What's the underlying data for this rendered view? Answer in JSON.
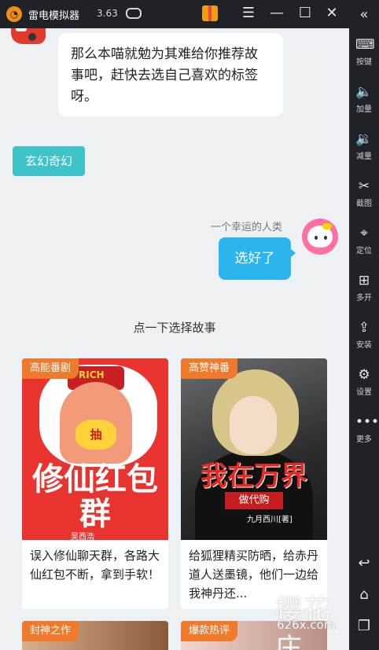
{
  "titlebar": {
    "app_title": "雷电模拟器",
    "version": "3.63"
  },
  "sidebar": {
    "items": [
      {
        "label": "按键",
        "icon": "keyboard-icon"
      },
      {
        "label": "加量",
        "icon": "volume-up-icon"
      },
      {
        "label": "减量",
        "icon": "volume-down-icon"
      },
      {
        "label": "截图",
        "icon": "scissors-icon"
      },
      {
        "label": "定位",
        "icon": "location-pin-icon"
      },
      {
        "label": "多开",
        "icon": "multi-open-icon"
      },
      {
        "label": "安装",
        "icon": "apk-install-icon"
      },
      {
        "label": "设置",
        "icon": "gear-icon"
      },
      {
        "label": "更多",
        "icon": "more-dots-icon"
      }
    ]
  },
  "chat": {
    "bot_message": "那么本喵就勉为其难给你推荐故事吧，赶快去选自己喜欢的标签呀。",
    "tag_selected": "玄幻奇幻",
    "user_name": "一个幸运的人类",
    "user_message": "选好了"
  },
  "stories": {
    "section_title": "点一下选择故事",
    "cards": [
      {
        "tag": "高能番剧",
        "cover_title": "修仙红包群",
        "cover_hat": "RICH",
        "cover_ingot": "抽",
        "cover_author": "吴西浩",
        "description": "误入修仙聊天群，各路大仙红包不断，拿到手软！"
      },
      {
        "tag": "高赞神番",
        "cover_title": "我在万界",
        "cover_subtitle": "做代购",
        "cover_author": "九月西川[著]",
        "description": "给狐狸精买防晒，给赤丹道人送墨镜，他们一边给我神丹还..."
      },
      {
        "tag": "封神之作"
      },
      {
        "tag": "爆款热评"
      }
    ]
  },
  "watermark": {
    "text": "樱花庄",
    "sub": "626x.com"
  }
}
